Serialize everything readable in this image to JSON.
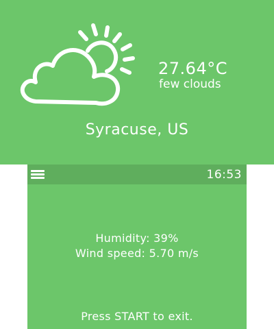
{
  "colors": {
    "background": "#6cc66a",
    "topbar": "#5fae5d",
    "text": "#ffffff"
  },
  "top_screen": {
    "icon": "few-clouds-icon",
    "temperature": "27.64°C",
    "description": "few clouds",
    "location": "Syracuse, US"
  },
  "bottom_screen": {
    "menu_icon": "hamburger-menu-icon",
    "time": "16:53",
    "humidity": "Humidity: 39%",
    "wind_speed": "Wind speed: 5.70 m/s",
    "exit_hint": "Press START to exit."
  }
}
